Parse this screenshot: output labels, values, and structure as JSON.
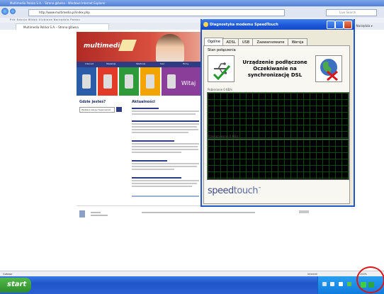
{
  "browser": {
    "window_title": "Multimedia Polska S.A. - Strona glówna - Windows Internet Explorer",
    "address": "http://www.multimedia.pl/index.php",
    "search_placeholder": "Live Search",
    "menu_text": "Plik   Edycja   Widok   Ulubione   Narzędzia   Pomoc",
    "tab_title": "Multimedia Polska S.A. - Strona glówna",
    "tools_text": "Strona ▾  Narzędzia ▾",
    "status_left": "Gotowe",
    "status_zone": "Internet",
    "status_zoom": "100%"
  },
  "site": {
    "logo": "multimedia",
    "nav": [
      "Internet",
      "Telewizja",
      "Telefonia",
      "Sieć",
      "Firmy"
    ],
    "welcome": "Witaj",
    "sidebar_title": "Gdzie jesteś?",
    "sidebar_select": "Wybierz swoją miejscowość",
    "news_title": "Aktualności",
    "tile_colors": [
      "#2a5caa",
      "#e23b2a",
      "#2e9a3a",
      "#f2a400",
      "#8a3d99"
    ]
  },
  "dialog": {
    "title": "Diagnostyka modemu SpeedTouch",
    "tabs": [
      "Ogólne",
      "ADSL",
      "USB",
      "Zaawansowane",
      "Wersja"
    ],
    "active_tab": "Ogólne",
    "section_label": "Stan połączenia",
    "status_lines": [
      "Urządzenie podłączone",
      "Oczekiwanie na",
      "synchronizację DSL"
    ],
    "download_label": "Pobieranie 0 KB/s",
    "upload_label": "Przekazywanie 0 KB/s",
    "brand_a": "speed",
    "brand_b": "touch",
    "brand_mark": "™"
  },
  "taskbar": {
    "start_label": "start"
  },
  "colors": {
    "xp_blue": "#2356c7",
    "graph_grid": "#0d4a12",
    "highlight": "#e01414"
  }
}
